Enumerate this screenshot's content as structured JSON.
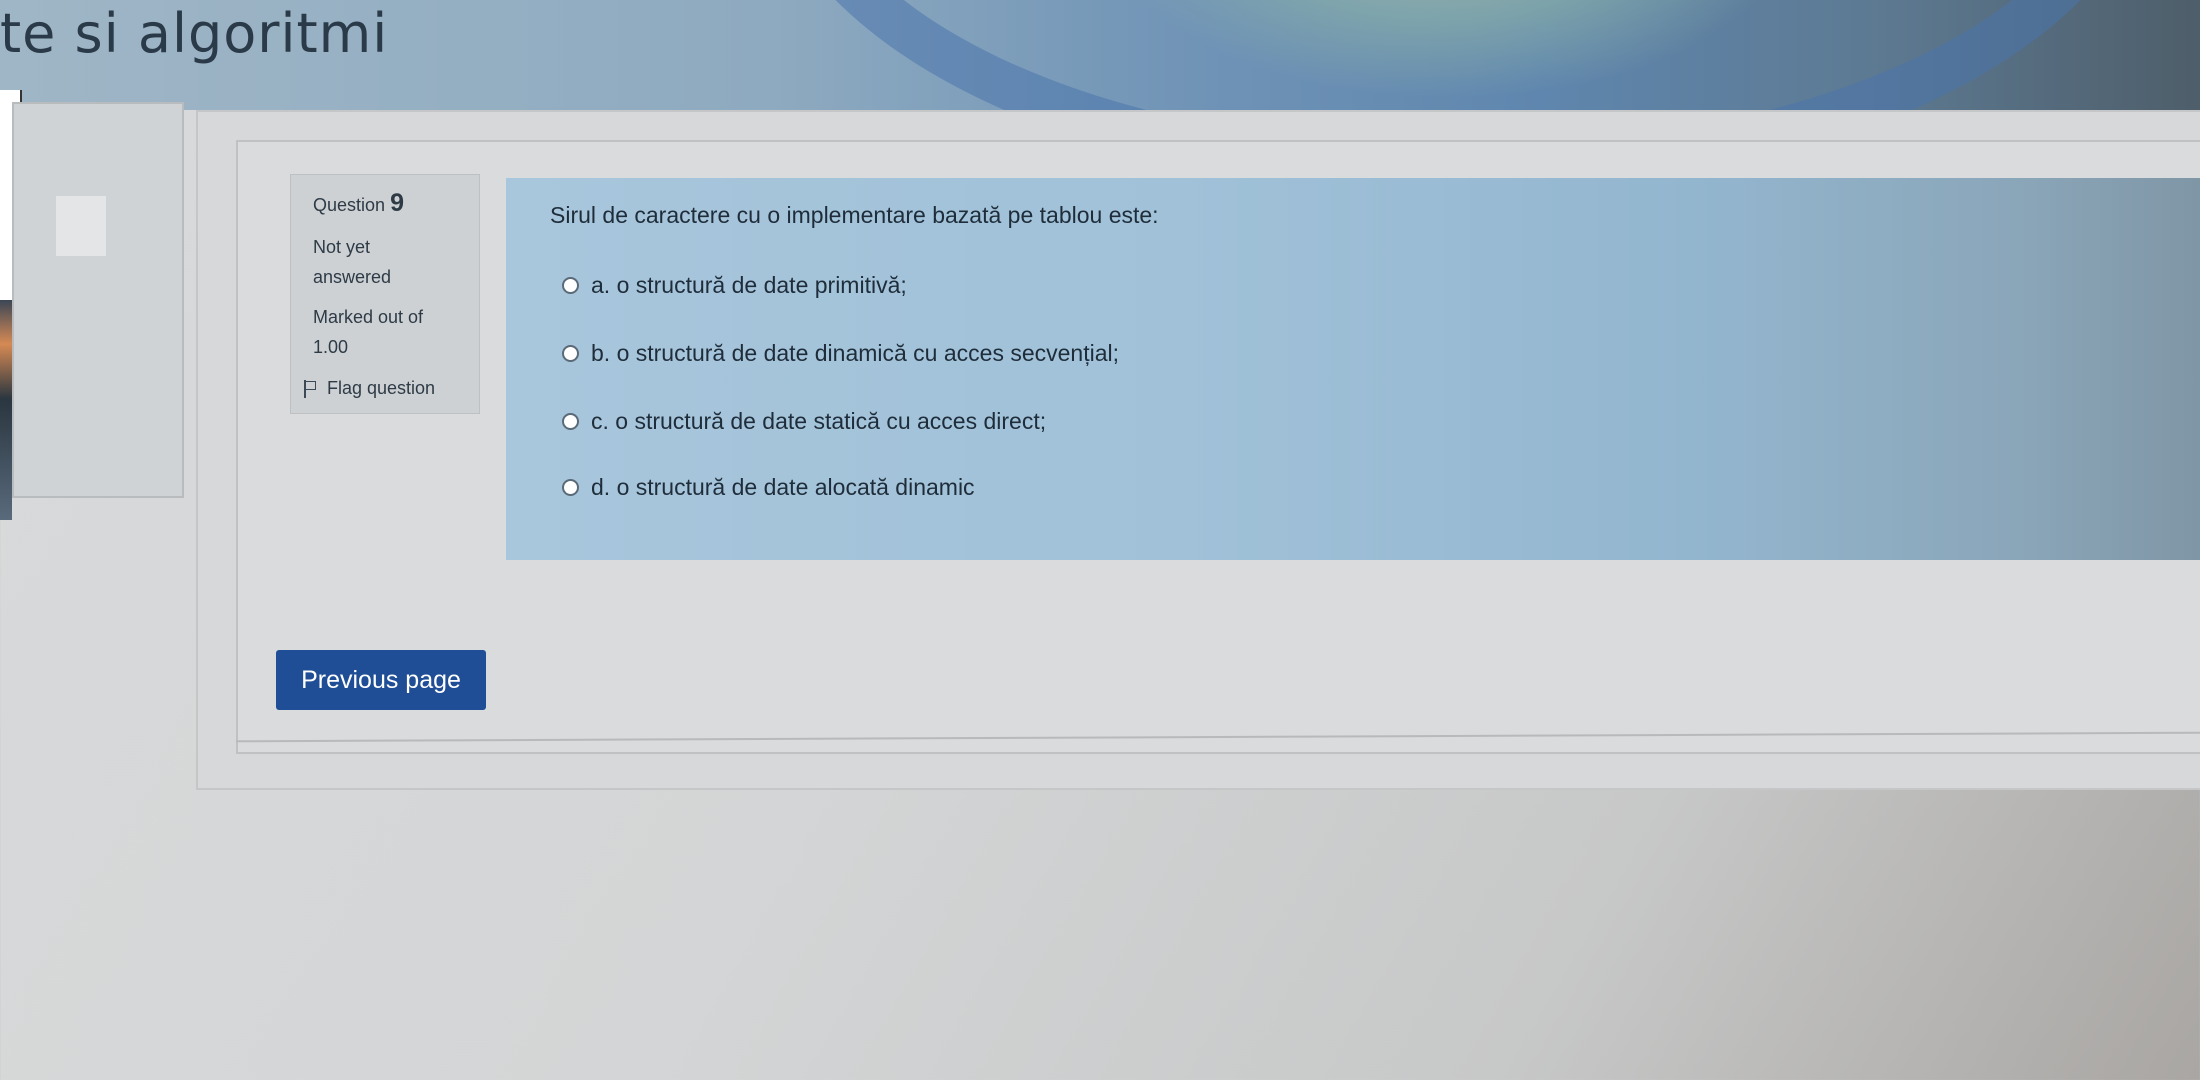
{
  "course": {
    "title_fragment": "te si algoritmi"
  },
  "question_info": {
    "label": "Question",
    "number": "9",
    "state": "Not yet answered",
    "marked_out_of": "Marked out of 1.00",
    "flag_label": "Flag question"
  },
  "question": {
    "text": "Sirul de caractere cu o implementare bazată pe tablou este:",
    "options": [
      {
        "label": "a. o structură de date primitivă;"
      },
      {
        "label": "b. o structură de date dinamică cu acces secvențial;"
      },
      {
        "label": "c. o structură de date statică cu acces direct;"
      },
      {
        "label": "d. o structură de date alocată dinamic"
      }
    ]
  },
  "navigation": {
    "previous_label": "Previous page"
  },
  "colors": {
    "button": "#1f4e96",
    "question_bg": "#a8c6dc",
    "info_bg": "#cdd1d4"
  }
}
